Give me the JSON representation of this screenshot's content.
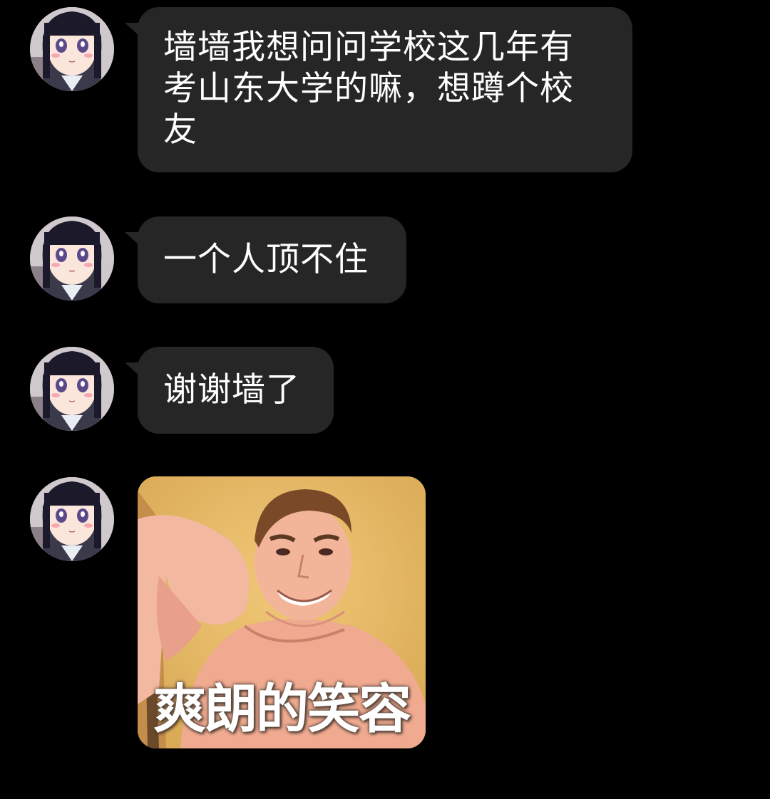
{
  "messages": [
    {
      "type": "text",
      "text": "墙墙我想问问学校这几年有考山东大学的嘛，想蹲个校友"
    },
    {
      "type": "text",
      "text": "一个人顶不住"
    },
    {
      "type": "text",
      "text": "谢谢墙了"
    },
    {
      "type": "sticker",
      "caption": "爽朗的笑容"
    }
  ],
  "colors": {
    "background": "#000000",
    "bubble": "#262626",
    "text": "#ffffff"
  },
  "icons": {
    "avatar": "anime-girl-avatar",
    "sticker": "smiling-man-sticker"
  }
}
